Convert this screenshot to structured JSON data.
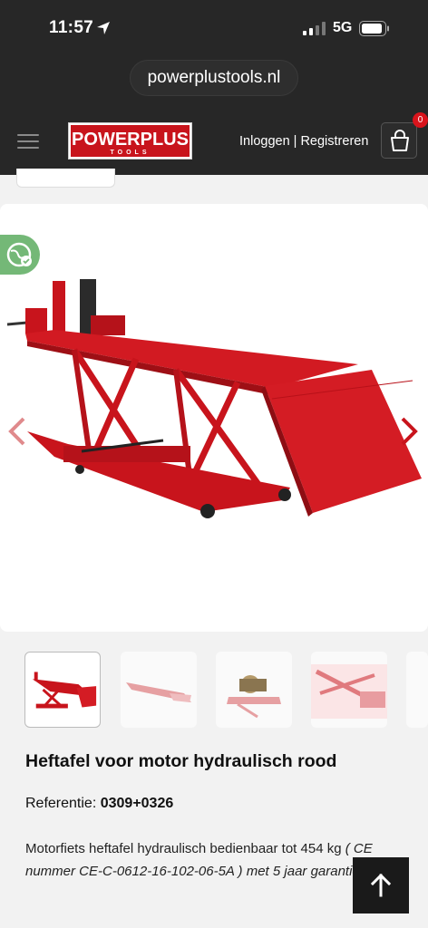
{
  "status": {
    "time": "11:57",
    "network": "5G"
  },
  "browser": {
    "url": "powerplustools.nl"
  },
  "header": {
    "logo_text": "POWERPLUS",
    "logo_sub": "TOOLS",
    "login_text": "Inloggen | Registreren",
    "cart_count": "0"
  },
  "product": {
    "title": "Heftafel voor motor hydraulisch rood",
    "reference_label": "Referentie:",
    "reference_value": "0309+0326",
    "description_plain": "Motorfiets heftafel hydraulisch bedienbaar tot 454 kg",
    "description_italic": "( CE nummer CE-C-0612-16-102-06-5A ) met 5 jaar garantie.",
    "thumbnails": [
      "table-side-view",
      "table-flat-view",
      "table-with-motorcycle",
      "table-closeup"
    ]
  },
  "colors": {
    "accent": "#d8141c",
    "header_bg": "#272727",
    "eco_green": "#74b877"
  },
  "icons": [
    "location-arrow-icon",
    "signal-icon",
    "battery-icon",
    "menu-icon",
    "cart-icon",
    "eco-globe-icon",
    "chevron-left-icon",
    "chevron-right-icon",
    "arrow-up-icon"
  ]
}
